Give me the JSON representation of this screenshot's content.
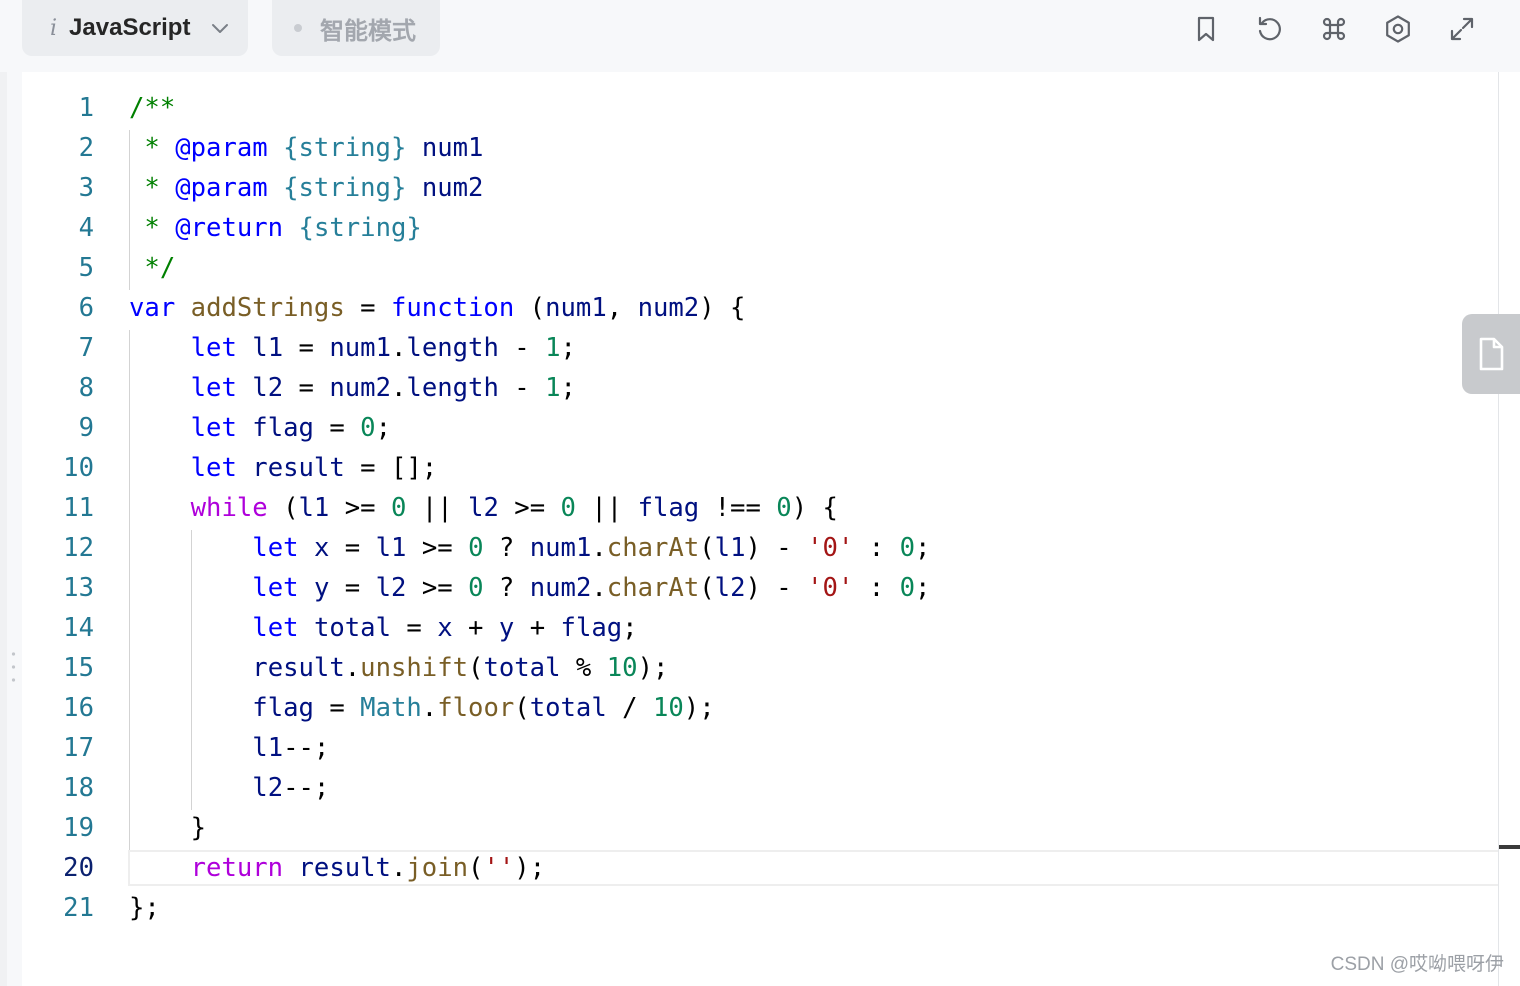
{
  "toolbar": {
    "language": "JavaScript",
    "language_icon_letter": "i",
    "mode": "智能模式",
    "icons": [
      "bookmark-icon",
      "reset-icon",
      "command-icon",
      "settings-icon",
      "fullscreen-icon"
    ]
  },
  "editor": {
    "active_line": 20,
    "colors": {
      "comment": "#008000",
      "keyword": "#0000ff",
      "control": "#af00db",
      "variable": "#001080",
      "function": "#795e26",
      "number": "#098658",
      "string": "#a31515",
      "type": "#267f99",
      "plain": "#000000",
      "line_number": "#237893"
    },
    "lines": [
      {
        "n": "1",
        "tokens": [
          [
            "/**",
            "comment"
          ]
        ]
      },
      {
        "n": "2",
        "tokens": [
          [
            " * ",
            "comment"
          ],
          [
            "@param",
            "keyword"
          ],
          [
            " ",
            "comment"
          ],
          [
            "{string}",
            "type"
          ],
          [
            " ",
            "comment"
          ],
          [
            "num1",
            "variable"
          ]
        ]
      },
      {
        "n": "3",
        "tokens": [
          [
            " * ",
            "comment"
          ],
          [
            "@param",
            "keyword"
          ],
          [
            " ",
            "comment"
          ],
          [
            "{string}",
            "type"
          ],
          [
            " ",
            "comment"
          ],
          [
            "num2",
            "variable"
          ]
        ]
      },
      {
        "n": "4",
        "tokens": [
          [
            " * ",
            "comment"
          ],
          [
            "@return",
            "keyword"
          ],
          [
            " ",
            "comment"
          ],
          [
            "{string}",
            "type"
          ]
        ]
      },
      {
        "n": "5",
        "tokens": [
          [
            " */",
            "comment"
          ]
        ]
      },
      {
        "n": "6",
        "tokens": [
          [
            "var",
            "keyword"
          ],
          [
            " ",
            "plain"
          ],
          [
            "addStrings",
            "function"
          ],
          [
            " = ",
            "plain"
          ],
          [
            "function",
            "keyword"
          ],
          [
            " (",
            "plain"
          ],
          [
            "num1",
            "variable"
          ],
          [
            ", ",
            "plain"
          ],
          [
            "num2",
            "variable"
          ],
          [
            ") {",
            "plain"
          ]
        ]
      },
      {
        "n": "7",
        "tokens": [
          [
            "    ",
            "plain"
          ],
          [
            "let",
            "keyword"
          ],
          [
            " ",
            "plain"
          ],
          [
            "l1",
            "variable"
          ],
          [
            " = ",
            "plain"
          ],
          [
            "num1",
            "variable"
          ],
          [
            ".",
            "plain"
          ],
          [
            "length",
            "variable"
          ],
          [
            " - ",
            "plain"
          ],
          [
            "1",
            "number"
          ],
          [
            ";",
            "plain"
          ]
        ]
      },
      {
        "n": "8",
        "tokens": [
          [
            "    ",
            "plain"
          ],
          [
            "let",
            "keyword"
          ],
          [
            " ",
            "plain"
          ],
          [
            "l2",
            "variable"
          ],
          [
            " = ",
            "plain"
          ],
          [
            "num2",
            "variable"
          ],
          [
            ".",
            "plain"
          ],
          [
            "length",
            "variable"
          ],
          [
            " - ",
            "plain"
          ],
          [
            "1",
            "number"
          ],
          [
            ";",
            "plain"
          ]
        ]
      },
      {
        "n": "9",
        "tokens": [
          [
            "    ",
            "plain"
          ],
          [
            "let",
            "keyword"
          ],
          [
            " ",
            "plain"
          ],
          [
            "flag",
            "variable"
          ],
          [
            " = ",
            "plain"
          ],
          [
            "0",
            "number"
          ],
          [
            ";",
            "plain"
          ]
        ]
      },
      {
        "n": "10",
        "tokens": [
          [
            "    ",
            "plain"
          ],
          [
            "let",
            "keyword"
          ],
          [
            " ",
            "plain"
          ],
          [
            "result",
            "variable"
          ],
          [
            " = [];",
            "plain"
          ]
        ]
      },
      {
        "n": "11",
        "tokens": [
          [
            "    ",
            "plain"
          ],
          [
            "while",
            "control"
          ],
          [
            " (",
            "plain"
          ],
          [
            "l1",
            "variable"
          ],
          [
            " >= ",
            "plain"
          ],
          [
            "0",
            "number"
          ],
          [
            " || ",
            "plain"
          ],
          [
            "l2",
            "variable"
          ],
          [
            " >= ",
            "plain"
          ],
          [
            "0",
            "number"
          ],
          [
            " || ",
            "plain"
          ],
          [
            "flag",
            "variable"
          ],
          [
            " !== ",
            "plain"
          ],
          [
            "0",
            "number"
          ],
          [
            ") {",
            "plain"
          ]
        ]
      },
      {
        "n": "12",
        "tokens": [
          [
            "        ",
            "plain"
          ],
          [
            "let",
            "keyword"
          ],
          [
            " ",
            "plain"
          ],
          [
            "x",
            "variable"
          ],
          [
            " = ",
            "plain"
          ],
          [
            "l1",
            "variable"
          ],
          [
            " >= ",
            "plain"
          ],
          [
            "0",
            "number"
          ],
          [
            " ? ",
            "plain"
          ],
          [
            "num1",
            "variable"
          ],
          [
            ".",
            "plain"
          ],
          [
            "charAt",
            "function"
          ],
          [
            "(",
            "plain"
          ],
          [
            "l1",
            "variable"
          ],
          [
            ") - ",
            "plain"
          ],
          [
            "'0'",
            "string"
          ],
          [
            " : ",
            "plain"
          ],
          [
            "0",
            "number"
          ],
          [
            ";",
            "plain"
          ]
        ]
      },
      {
        "n": "13",
        "tokens": [
          [
            "        ",
            "plain"
          ],
          [
            "let",
            "keyword"
          ],
          [
            " ",
            "plain"
          ],
          [
            "y",
            "variable"
          ],
          [
            " = ",
            "plain"
          ],
          [
            "l2",
            "variable"
          ],
          [
            " >= ",
            "plain"
          ],
          [
            "0",
            "number"
          ],
          [
            " ? ",
            "plain"
          ],
          [
            "num2",
            "variable"
          ],
          [
            ".",
            "plain"
          ],
          [
            "charAt",
            "function"
          ],
          [
            "(",
            "plain"
          ],
          [
            "l2",
            "variable"
          ],
          [
            ") - ",
            "plain"
          ],
          [
            "'0'",
            "string"
          ],
          [
            " : ",
            "plain"
          ],
          [
            "0",
            "number"
          ],
          [
            ";",
            "plain"
          ]
        ]
      },
      {
        "n": "14",
        "tokens": [
          [
            "        ",
            "plain"
          ],
          [
            "let",
            "keyword"
          ],
          [
            " ",
            "plain"
          ],
          [
            "total",
            "variable"
          ],
          [
            " = ",
            "plain"
          ],
          [
            "x",
            "variable"
          ],
          [
            " + ",
            "plain"
          ],
          [
            "y",
            "variable"
          ],
          [
            " + ",
            "plain"
          ],
          [
            "flag",
            "variable"
          ],
          [
            ";",
            "plain"
          ]
        ]
      },
      {
        "n": "15",
        "tokens": [
          [
            "        ",
            "plain"
          ],
          [
            "result",
            "variable"
          ],
          [
            ".",
            "plain"
          ],
          [
            "unshift",
            "function"
          ],
          [
            "(",
            "plain"
          ],
          [
            "total",
            "variable"
          ],
          [
            " % ",
            "plain"
          ],
          [
            "10",
            "number"
          ],
          [
            ");",
            "plain"
          ]
        ]
      },
      {
        "n": "16",
        "tokens": [
          [
            "        ",
            "plain"
          ],
          [
            "flag",
            "variable"
          ],
          [
            " = ",
            "plain"
          ],
          [
            "Math",
            "type"
          ],
          [
            ".",
            "plain"
          ],
          [
            "floor",
            "function"
          ],
          [
            "(",
            "plain"
          ],
          [
            "total",
            "variable"
          ],
          [
            " / ",
            "plain"
          ],
          [
            "10",
            "number"
          ],
          [
            ");",
            "plain"
          ]
        ]
      },
      {
        "n": "17",
        "tokens": [
          [
            "        ",
            "plain"
          ],
          [
            "l1",
            "variable"
          ],
          [
            "--;",
            "plain"
          ]
        ]
      },
      {
        "n": "18",
        "tokens": [
          [
            "        ",
            "plain"
          ],
          [
            "l2",
            "variable"
          ],
          [
            "--;",
            "plain"
          ]
        ]
      },
      {
        "n": "19",
        "tokens": [
          [
            "    }",
            "plain"
          ]
        ]
      },
      {
        "n": "20",
        "tokens": [
          [
            "    ",
            "plain"
          ],
          [
            "return",
            "control"
          ],
          [
            " ",
            "plain"
          ],
          [
            "result",
            "variable"
          ],
          [
            ".",
            "plain"
          ],
          [
            "join",
            "function"
          ],
          [
            "(",
            "plain"
          ],
          [
            "''",
            "string"
          ],
          [
            ");",
            "plain"
          ]
        ]
      },
      {
        "n": "21",
        "tokens": [
          [
            "};",
            "plain"
          ]
        ]
      }
    ]
  },
  "watermark": "CSDN @哎呦喂呀伊"
}
